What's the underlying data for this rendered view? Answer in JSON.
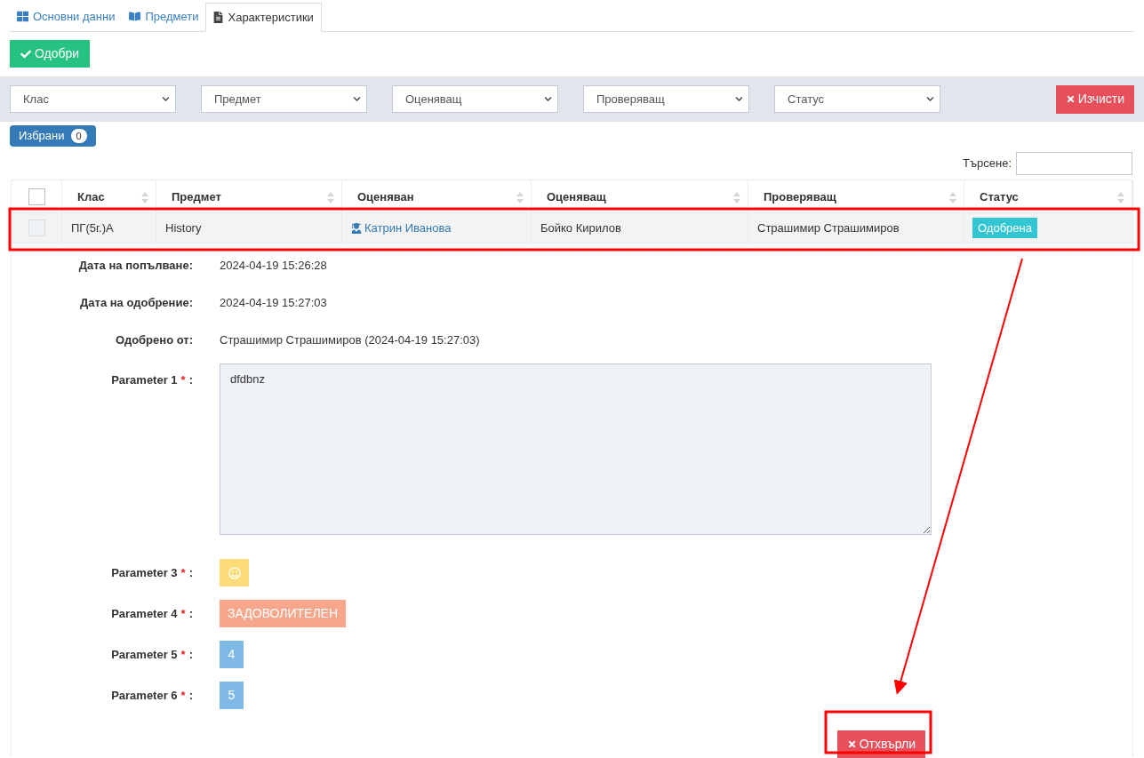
{
  "tabs": [
    {
      "label": "Основни данни",
      "selected": false
    },
    {
      "label": "Предмети",
      "selected": false
    },
    {
      "label": "Характеристики",
      "selected": true
    }
  ],
  "approve_button": "Одобри",
  "filters": [
    "Клас",
    "Предмет",
    "Оценяващ",
    "Проверяващ",
    "Статус"
  ],
  "clear_button": "Изчисти",
  "selected_badge": {
    "label": "Избрани",
    "count": "0"
  },
  "search": {
    "label": "Търсене:"
  },
  "table": {
    "select_all": {
      "checked": false
    },
    "columns": [
      "Клас",
      "Предмет",
      "Оценяван",
      "Оценяващ",
      "Проверяващ",
      "Статус"
    ],
    "rows": [
      {
        "checked": false,
        "cells": [
          "ПГ(5г.)А",
          "History",
          "Катрин Иванова",
          "Бойко Кирилов",
          "Страшимир Страшимиров"
        ],
        "status": "Одобрена"
      }
    ]
  },
  "details": [
    {
      "label": "Дата на попълване:",
      "value": "2024-04-19 15:26:28"
    },
    {
      "label": "Дата на одобрение:",
      "value": "2024-04-19 15:27:03"
    },
    {
      "label": "Одобрено от:",
      "value": "Страшимир Страшимиров (2024-04-19 15:27:03)"
    }
  ],
  "parameters": [
    {
      "label": "Parameter 1",
      "required_mark": "*",
      "separator": ":",
      "kind": "text",
      "value": "dfdbnz"
    },
    {
      "label": "Parameter 3",
      "required_mark": "*",
      "separator": ":",
      "kind": "smiley",
      "color": "#fbdc78"
    },
    {
      "label": "Parameter 4",
      "required_mark": "*",
      "separator": ":",
      "kind": "badge",
      "value": "ЗАДОВОЛИТЕЛЕН",
      "color": "#f6a78b"
    },
    {
      "label": "Parameter 5",
      "required_mark": "*",
      "separator": ":",
      "kind": "badge",
      "value": "4",
      "color": "#7fbae6"
    },
    {
      "label": "Parameter 6",
      "required_mark": "*",
      "separator": ":",
      "kind": "badge",
      "value": "5",
      "color": "#7fbae6"
    }
  ],
  "reject_button": "Отхвърли"
}
